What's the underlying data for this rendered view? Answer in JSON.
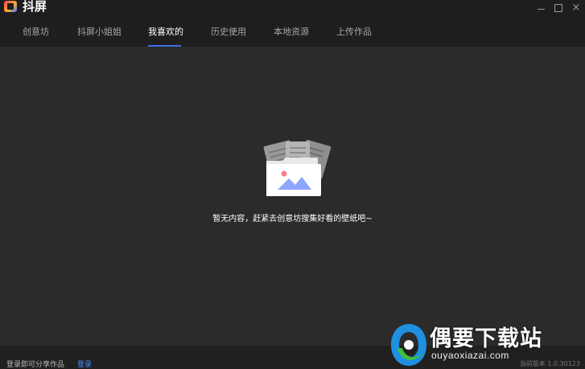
{
  "app": {
    "title": "抖屏"
  },
  "tabs": [
    {
      "label": "创意坊"
    },
    {
      "label": "抖屏小姐姐"
    },
    {
      "label": "我喜欢的"
    },
    {
      "label": "历史使用"
    },
    {
      "label": "本地资源"
    },
    {
      "label": "上传作品"
    }
  ],
  "active_tab": "我喜欢的",
  "empty_state": {
    "message": "暂无内容，赶紧去创意坊搜集好看的壁纸吧~"
  },
  "footer": {
    "prompt": "登录即可分享作品",
    "login_label": "登录",
    "version": "当前版本 1.0.30123"
  },
  "watermark": {
    "title": "偶要下载站",
    "url": "ouyaoxiazai.com"
  },
  "colors": {
    "accent": "#3b6fe8",
    "background": "#2b2b2b",
    "chrome": "#1e1e1e",
    "link": "#4d8cff"
  }
}
